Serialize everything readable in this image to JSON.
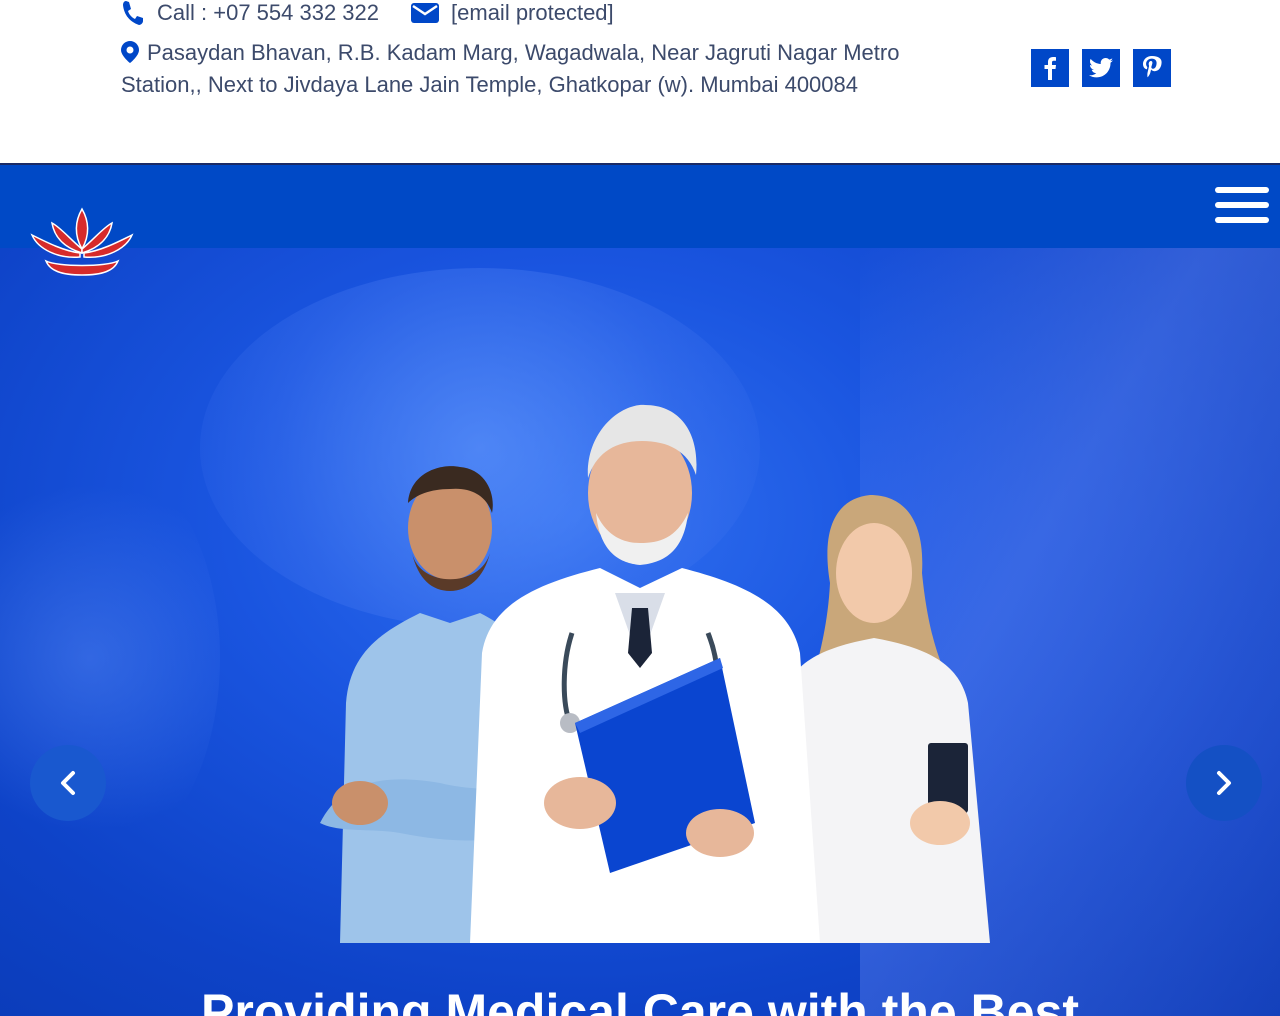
{
  "topbar": {
    "phone_label": "Call : +07 554 332 322",
    "email_label": "[email protected]",
    "address": "Pasaydan Bhavan, R.B. Kadam Marg, Wagadwala, Near Jagruti Nagar Metro Station,, Next to Jivdaya Lane Jain Temple, Ghatkopar (w). Mumbai 400084",
    "icons": {
      "phone": "phone-icon",
      "email": "envelope-icon",
      "address": "map-pin-icon"
    }
  },
  "social": [
    {
      "name": "facebook",
      "glyph": "f"
    },
    {
      "name": "twitter",
      "glyph": ""
    },
    {
      "name": "pinterest",
      "glyph": "P"
    }
  ],
  "navbar": {
    "menu_icon": "hamburger-menu-icon"
  },
  "logo": {
    "description": "red-lotus-logo"
  },
  "hero": {
    "title": "Providing Medical Care with the Best",
    "prev_icon": "chevron-left-icon",
    "next_icon": "chevron-right-icon"
  },
  "colors": {
    "brand_blue": "#0049c6",
    "text_gray": "#3c4a6b",
    "logo_red": "#d62b2b"
  }
}
